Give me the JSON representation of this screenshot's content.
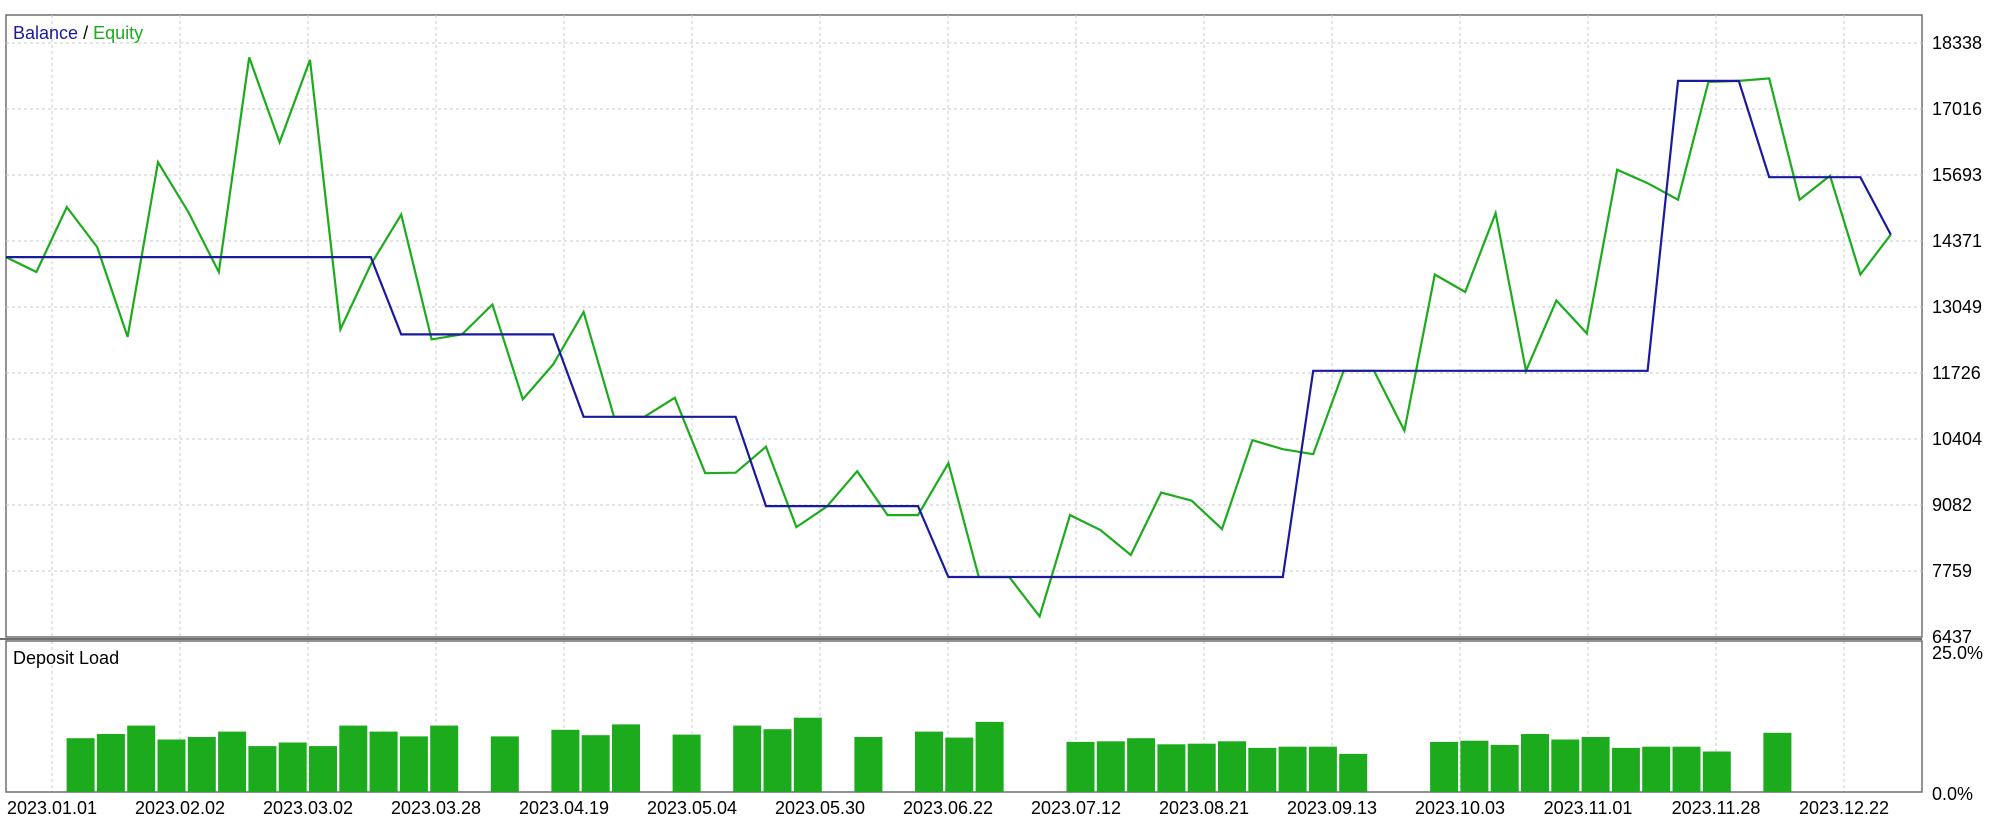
{
  "colors": {
    "balance": "#1a1a9e",
    "equity": "#1cab1c",
    "bars": "#1cab1c",
    "grid": "#c8c8c8",
    "frame": "#6e6e6e",
    "background": "#ffffff"
  },
  "chart_data": [
    {
      "type": "line",
      "title": "",
      "legend": {
        "placement": "top-left",
        "separator": "/",
        "entries": [
          "Balance",
          "Equity"
        ]
      },
      "grid": true,
      "y_ticks": [
        "18338",
        "17016",
        "15693",
        "14371",
        "13049",
        "11726",
        "10404",
        "9082",
        "7759",
        "6437"
      ],
      "ylim": [
        6437,
        18900
      ],
      "x_ticks": [
        "2023.01.01",
        "2023.02.02",
        "2023.03.02",
        "2023.03.28",
        "2023.04.19",
        "2023.05.04",
        "2023.05.30",
        "2023.06.22",
        "2023.07.12",
        "2023.08.21",
        "2023.09.13",
        "2023.10.03",
        "2023.11.01",
        "2023.11.28",
        "2023.12.22"
      ],
      "series": [
        {
          "name": "Balance",
          "x": [
            0,
            12,
            13,
            18,
            19,
            24,
            25,
            30,
            31,
            42,
            43,
            54,
            55,
            57,
            58,
            61,
            62
          ],
          "values": [
            14050,
            14050,
            12500,
            12500,
            10850,
            10850,
            9060,
            9060,
            7640,
            7640,
            11770,
            11770,
            17580,
            17580,
            15650,
            15650,
            14500
          ]
        },
        {
          "name": "Equity",
          "x": [
            0,
            1,
            2,
            3,
            4,
            5,
            6,
            7,
            8,
            9,
            10,
            11,
            12,
            13,
            14,
            15,
            16,
            17,
            18,
            19,
            20,
            21,
            22,
            23,
            24,
            25,
            26,
            27,
            28,
            29,
            30,
            31,
            32,
            33,
            34,
            35,
            36,
            37,
            38,
            39,
            40,
            41,
            42,
            43,
            44,
            45,
            46,
            47,
            48,
            49,
            50,
            51,
            52,
            53,
            54,
            55,
            56,
            57,
            58,
            59,
            60,
            61,
            62
          ],
          "values": [
            14050,
            13750,
            15050,
            14250,
            12450,
            15950,
            14950,
            13750,
            18050,
            16350,
            18000,
            12600,
            13900,
            14900,
            12400,
            12500,
            13100,
            11200,
            11900,
            12950,
            10850,
            10850,
            11230,
            9720,
            9730,
            10250,
            8640,
            9050,
            9760,
            8880,
            8880,
            9920,
            7640,
            7640,
            6850,
            8880,
            8580,
            8080,
            9330,
            9170,
            8600,
            10380,
            10200,
            10100,
            11770,
            11770,
            10570,
            13700,
            13350,
            14930,
            11770,
            13180,
            12520,
            15800,
            15530,
            15200,
            17560,
            17580,
            17630,
            15200,
            15680,
            13700,
            14500
          ]
        }
      ]
    },
    {
      "type": "bar",
      "title": "Deposit Load",
      "y_ticks": [
        "25.0%",
        "0.0%"
      ],
      "ylim": [
        0,
        25
      ],
      "values": [
        0,
        0,
        8.9,
        9.6,
        11.0,
        8.7,
        9.1,
        10.0,
        7.6,
        8.2,
        7.6,
        11.0,
        10.0,
        9.2,
        11.0,
        0,
        9.2,
        0,
        10.3,
        9.4,
        11.2,
        0,
        9.5,
        0,
        11.0,
        10.4,
        12.3,
        0,
        9.1,
        0,
        10.0,
        9.0,
        11.6,
        0,
        0,
        8.3,
        8.4,
        8.9,
        7.9,
        8.0,
        8.4,
        7.3,
        7.5,
        7.5,
        6.3,
        0,
        0,
        8.3,
        8.5,
        7.8,
        9.6,
        8.7,
        9.1,
        7.3,
        7.5,
        7.5,
        6.7,
        0,
        9.8,
        0,
        0
      ]
    }
  ]
}
